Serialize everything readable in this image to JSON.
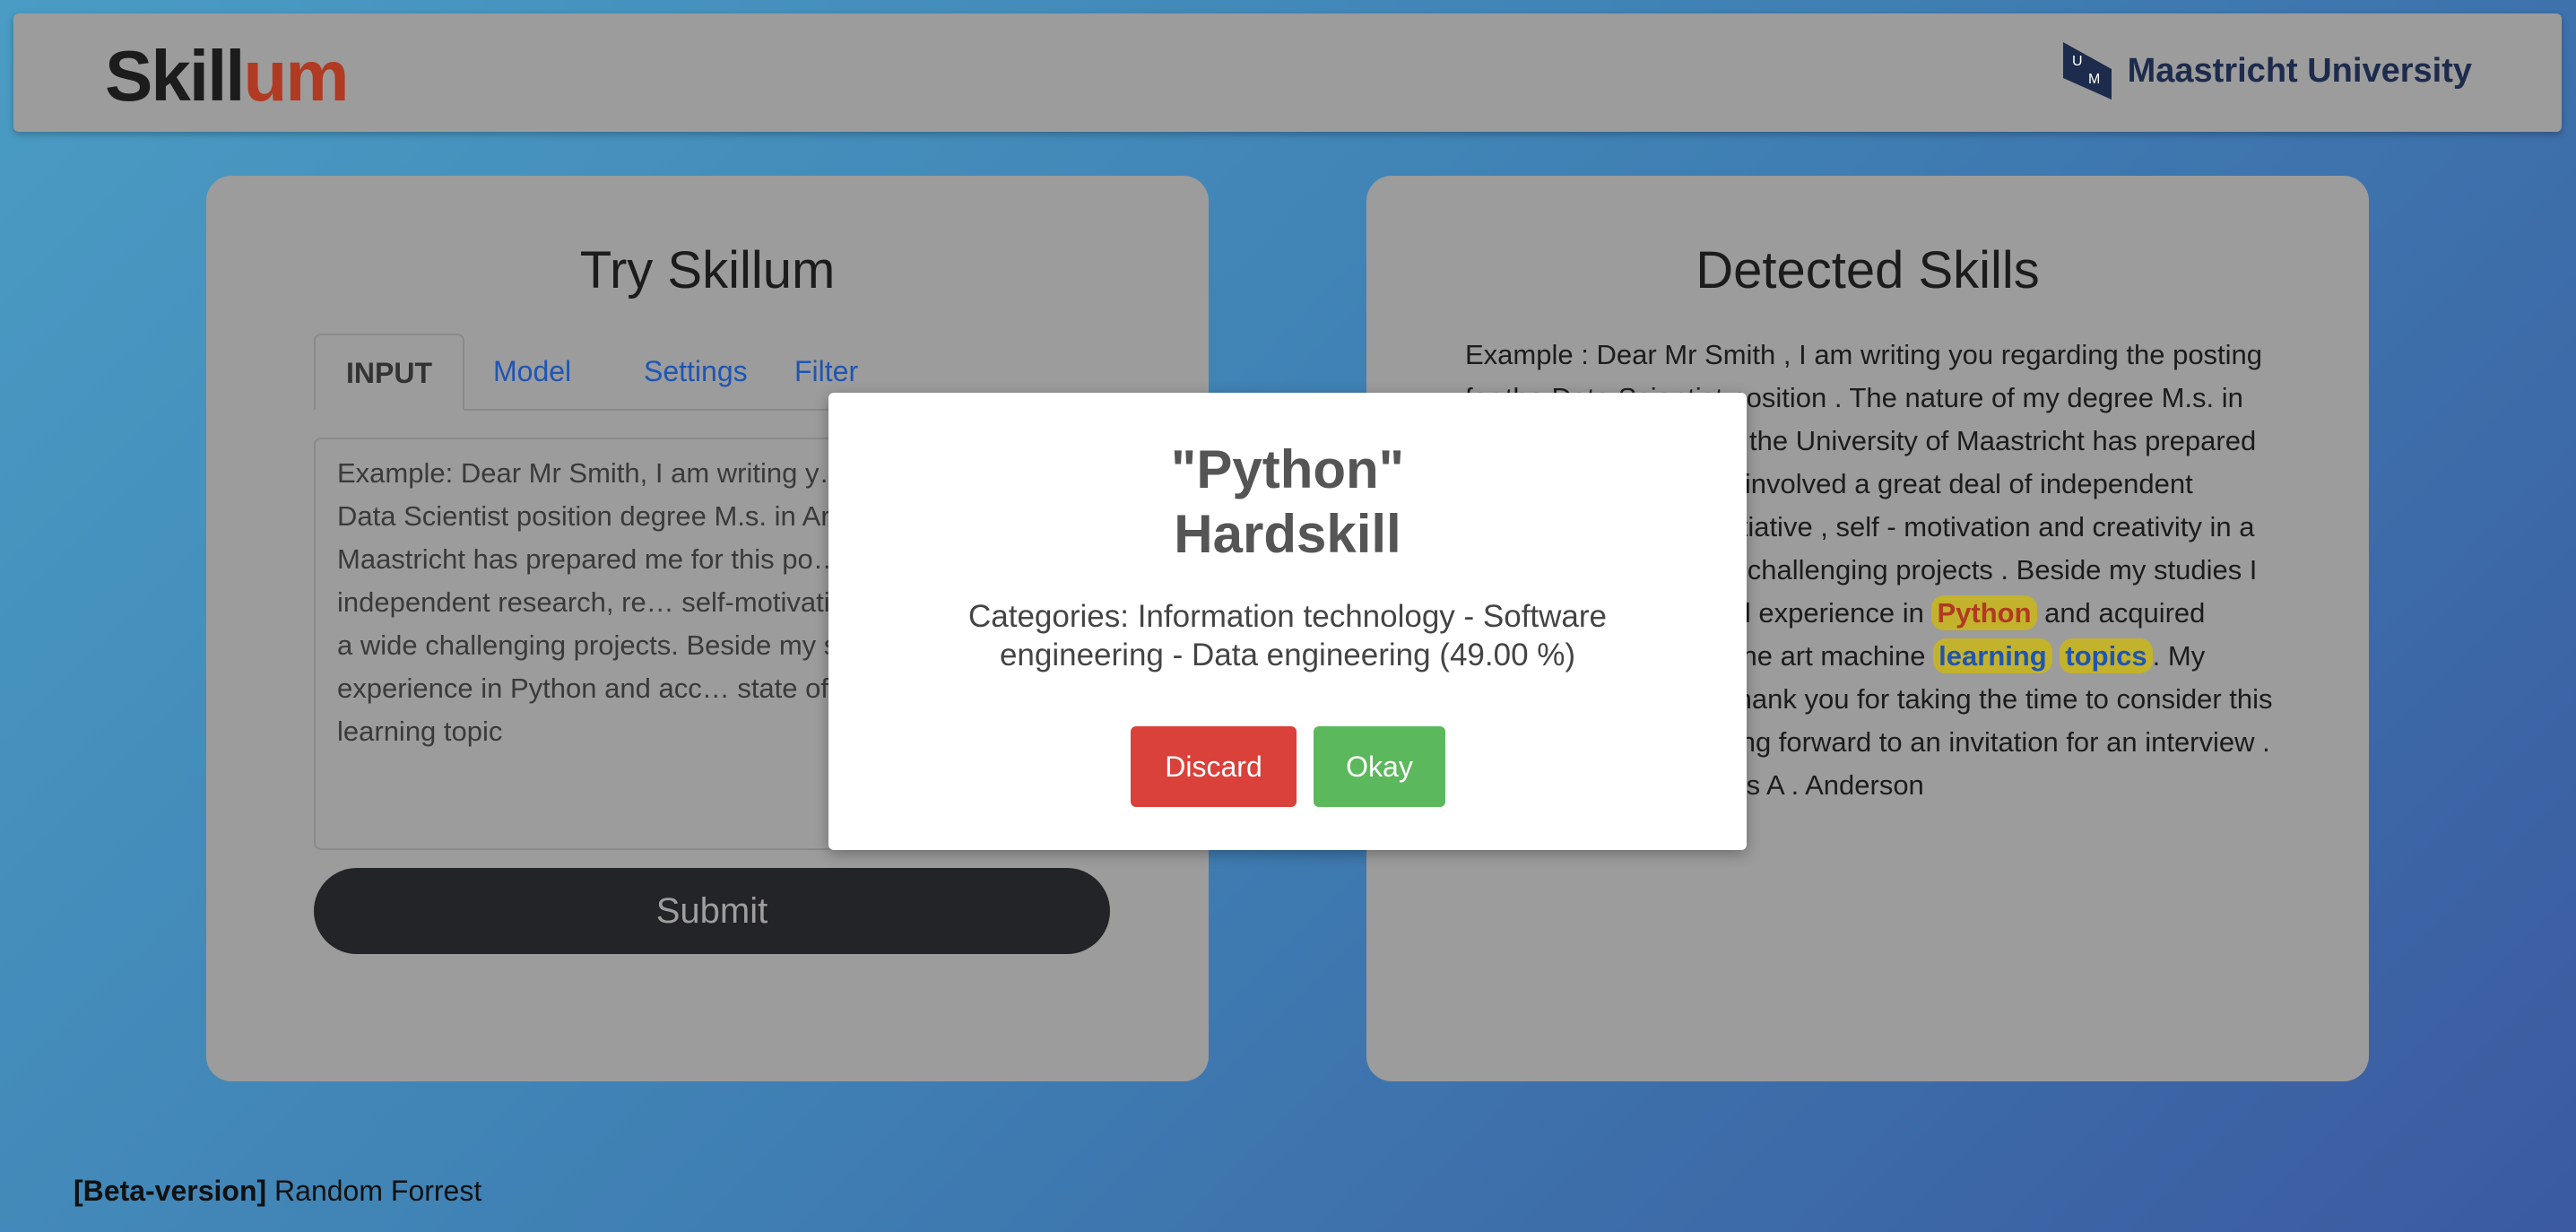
{
  "header": {
    "logo_part1": "Skill",
    "logo_part2": "um",
    "university_name": "Maastricht University",
    "university_mark_letters": "UM"
  },
  "input_card": {
    "title": "Try Skillum",
    "tabs": [
      {
        "label": "INPUT",
        "active": true
      },
      {
        "label": "Model",
        "active": false
      },
      {
        "label": "Settings",
        "active": false
      },
      {
        "label": "Filter",
        "active": false
      }
    ],
    "textarea_value": "Example: Dear Mr Smith, I am writing y… posting for the Data Scientist position degree M.s. in Artificial Intelligence at Maastricht has prepared me for this po… great deal of independent research, re… self-motivation and creativity in a wide challenging projects. Beside my studie… practical experience in Python and acc… state of the art machine learning topic",
    "submit_label": "Submit"
  },
  "detected_card": {
    "title": "Detected Skills",
    "text_before_python": "Example : Dear Mr Smith , I am writing you regarding the posting for the Data Scientist position . The nature of my degree M.s. in Artificial Intelligence at the University of Maastricht has prepared me for this position . It involved a great deal of independent research , requiring initiative , self - motivation and creativity in a wide range of different challenging projects . Beside my studies I gained a lot of practical experience in",
    "skill_python": "Python",
    "text_mid": "and acquired knowledge in state of the art machine",
    "skill_learning": "learning",
    "skill_topics": "topics",
    "text_after": ". My programming skills . Thank you for taking the time to consider this application . I am looking forward to an invitation for an interview . Yours sincerely Thomas A . Anderson"
  },
  "modal": {
    "skill_name": "\"Python\"",
    "skill_type": "Hardskill",
    "categories_text": "Categories: Information technology - Software engineering - Data engineering (49.00 %)",
    "discard_label": "Discard",
    "okay_label": "Okay"
  },
  "footer": {
    "beta_label": "[Beta-version]",
    "model_name": "Random Forrest"
  },
  "colors": {
    "logo_accent": "#b03a22",
    "discard_button": "#d9413a",
    "okay_button": "#5cb85c",
    "skill_highlight": "#c3b22c",
    "tab_link": "#1f55b3",
    "submit_button": "#222427"
  }
}
